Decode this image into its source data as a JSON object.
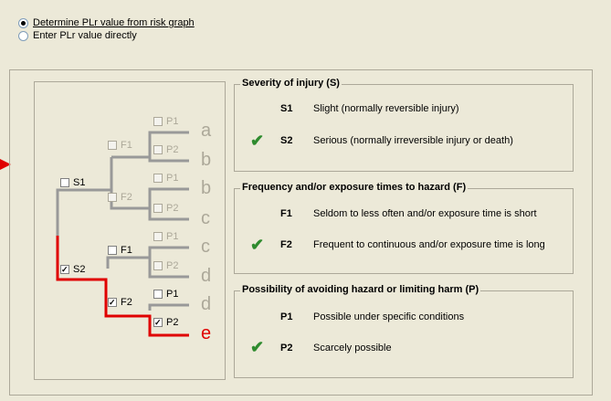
{
  "mode_options": [
    {
      "label": "Determine PLr value from risk graph",
      "selected": true
    },
    {
      "label": "Enter PLr value directly",
      "selected": false
    }
  ],
  "tree": {
    "s1": "S1",
    "s2": "S2",
    "f1_top": "F1",
    "f2_top": "F2",
    "f1_bottom": "F1",
    "f2_bottom": "F2",
    "p1": "P1",
    "p2": "P2",
    "leaves": [
      "a",
      "b",
      "b",
      "c",
      "c",
      "d",
      "d",
      "e"
    ],
    "selected_leaf": "e",
    "path_color": "#e00000",
    "inactive_color": "#999999"
  },
  "severity": {
    "title": "Severity of injury (S)",
    "options": [
      {
        "code": "S1",
        "text": "Slight (normally reversible injury)",
        "checked": false
      },
      {
        "code": "S2",
        "text": "Serious (normally irreversible injury or death)",
        "checked": true
      }
    ]
  },
  "frequency": {
    "title": "Frequency and/or exposure times to hazard (F)",
    "options": [
      {
        "code": "F1",
        "text": "Seldom to less often and/or exposure time is short",
        "checked": false
      },
      {
        "code": "F2",
        "text": "Frequent to continuous and/or exposure time is long",
        "checked": true
      }
    ]
  },
  "possibility": {
    "title": "Possibility of avoiding hazard or limiting harm (P)",
    "options": [
      {
        "code": "P1",
        "text": "Possible under specific conditions",
        "checked": false
      },
      {
        "code": "P2",
        "text": "Scarcely possible",
        "checked": true
      }
    ]
  },
  "check_glyph": "✔",
  "colors": {
    "check": "#2e8b2e",
    "arrow": "#e00000"
  }
}
